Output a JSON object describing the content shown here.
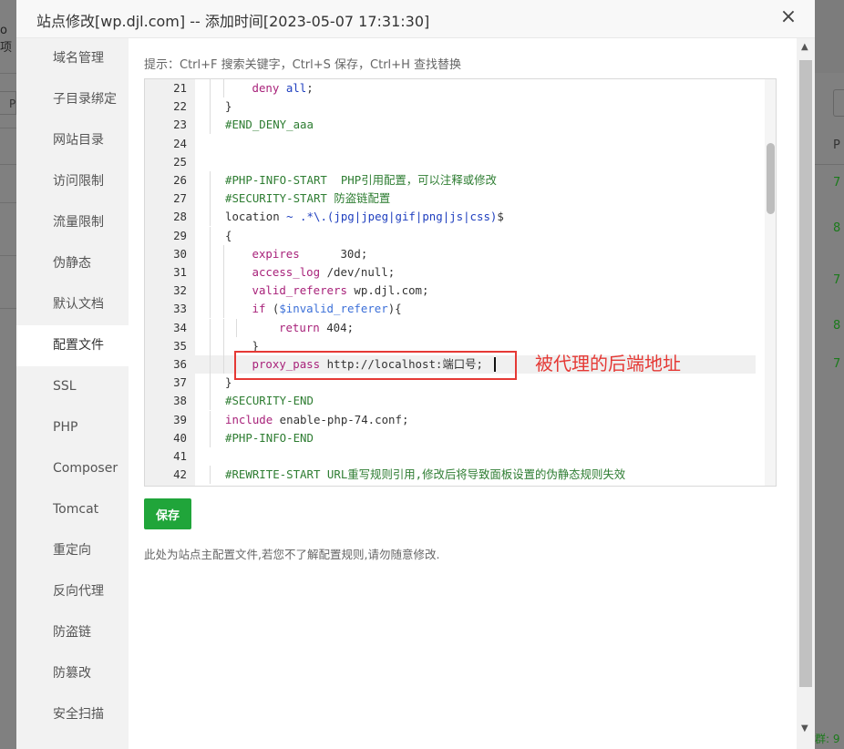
{
  "background": {
    "left_text": "o项",
    "left_box_text": "P",
    "right_header": "P",
    "right_values": [
      "7",
      "8",
      "7",
      "8",
      "7"
    ],
    "right_footer": "群: 9"
  },
  "modal": {
    "title": "站点修改[wp.djl.com] -- 添加时间[2023-05-07 17:31:30]",
    "close_icon": "×"
  },
  "sidebar": {
    "items": [
      {
        "label": "域名管理"
      },
      {
        "label": "子目录绑定"
      },
      {
        "label": "网站目录"
      },
      {
        "label": "访问限制"
      },
      {
        "label": "流量限制"
      },
      {
        "label": "伪静态"
      },
      {
        "label": "默认文档"
      },
      {
        "label": "配置文件"
      },
      {
        "label": "SSL"
      },
      {
        "label": "PHP"
      },
      {
        "label": "Composer"
      },
      {
        "label": "Tomcat"
      },
      {
        "label": "重定向"
      },
      {
        "label": "反向代理"
      },
      {
        "label": "防盗链"
      },
      {
        "label": "防篡改"
      },
      {
        "label": "安全扫描"
      }
    ],
    "active_index": 7
  },
  "content": {
    "hint": "提示：Ctrl+F 搜索关键字，Ctrl+S 保存，Ctrl+H 查找替换",
    "save_label": "保存",
    "note": "此处为站点主配置文件,若您不了解配置规则,请勿随意修改.",
    "annotation": "被代理的后端地址"
  },
  "editor": {
    "active_line": 36,
    "lines": [
      {
        "n": "21",
        "indent": 2,
        "tokens": [
          [
            "kw",
            "deny "
          ],
          [
            "blue",
            "all"
          ],
          [
            "plain",
            ";"
          ]
        ]
      },
      {
        "n": "22",
        "indent": 1,
        "tokens": [
          [
            "plain",
            "}"
          ]
        ]
      },
      {
        "n": "23",
        "indent": 1,
        "tokens": [
          [
            "comment",
            "#END_DENY_aaa"
          ]
        ]
      },
      {
        "n": "24",
        "indent": 0,
        "tokens": []
      },
      {
        "n": "25",
        "indent": 0,
        "tokens": []
      },
      {
        "n": "26",
        "indent": 1,
        "tokens": [
          [
            "comment",
            "#PHP-INFO-START  PHP引用配置，可以注释或修改"
          ]
        ]
      },
      {
        "n": "27",
        "indent": 1,
        "tokens": [
          [
            "comment",
            "#SECURITY-START 防盗链配置"
          ]
        ]
      },
      {
        "n": "28",
        "indent": 1,
        "tokens": [
          [
            "plain",
            "location "
          ],
          [
            "blue",
            "~ .*\\.(jpg|jpeg|gif|png|js|css)"
          ],
          [
            "plain",
            "$"
          ]
        ]
      },
      {
        "n": "29",
        "indent": 1,
        "tokens": [
          [
            "plain",
            "{"
          ]
        ]
      },
      {
        "n": "30",
        "indent": 2,
        "tokens": [
          [
            "kw",
            "expires"
          ],
          [
            "plain",
            "      30d;"
          ]
        ]
      },
      {
        "n": "31",
        "indent": 2,
        "tokens": [
          [
            "kw",
            "access_log"
          ],
          [
            "plain",
            " /dev/null;"
          ]
        ]
      },
      {
        "n": "32",
        "indent": 2,
        "tokens": [
          [
            "kw",
            "valid_referers"
          ],
          [
            "plain",
            " wp.djl.com;"
          ]
        ]
      },
      {
        "n": "33",
        "indent": 2,
        "tokens": [
          [
            "kw",
            "if"
          ],
          [
            "plain",
            " ("
          ],
          [
            "var",
            "$invalid_referer"
          ],
          [
            "plain",
            "){"
          ]
        ]
      },
      {
        "n": "34",
        "indent": 3,
        "tokens": [
          [
            "kw",
            "return"
          ],
          [
            "plain",
            " 404;"
          ]
        ]
      },
      {
        "n": "35",
        "indent": 2,
        "tokens": [
          [
            "plain",
            "}"
          ]
        ]
      },
      {
        "n": "36",
        "indent": 2,
        "tokens": [
          [
            "kw",
            "proxy_pass"
          ],
          [
            "plain",
            " http://localhost:端口号;"
          ]
        ]
      },
      {
        "n": "37",
        "indent": 1,
        "tokens": [
          [
            "plain",
            "}"
          ]
        ]
      },
      {
        "n": "38",
        "indent": 1,
        "tokens": [
          [
            "comment",
            "#SECURITY-END"
          ]
        ]
      },
      {
        "n": "39",
        "indent": 1,
        "tokens": [
          [
            "kw",
            "include"
          ],
          [
            "plain",
            " enable-php-74.conf;"
          ]
        ]
      },
      {
        "n": "40",
        "indent": 1,
        "tokens": [
          [
            "comment",
            "#PHP-INFO-END"
          ]
        ]
      },
      {
        "n": "41",
        "indent": 0,
        "tokens": []
      },
      {
        "n": "42",
        "indent": 1,
        "tokens": [
          [
            "comment",
            "#REWRITE-START URL重写规则引用,修改后将导致面板设置的伪静态规则失效"
          ]
        ]
      }
    ]
  },
  "colors": {
    "accent": "#20a53a",
    "annotation": "#e53935",
    "keyword": "#a8227a",
    "comment": "#2e7d32",
    "regex": "#1f3fbf"
  }
}
